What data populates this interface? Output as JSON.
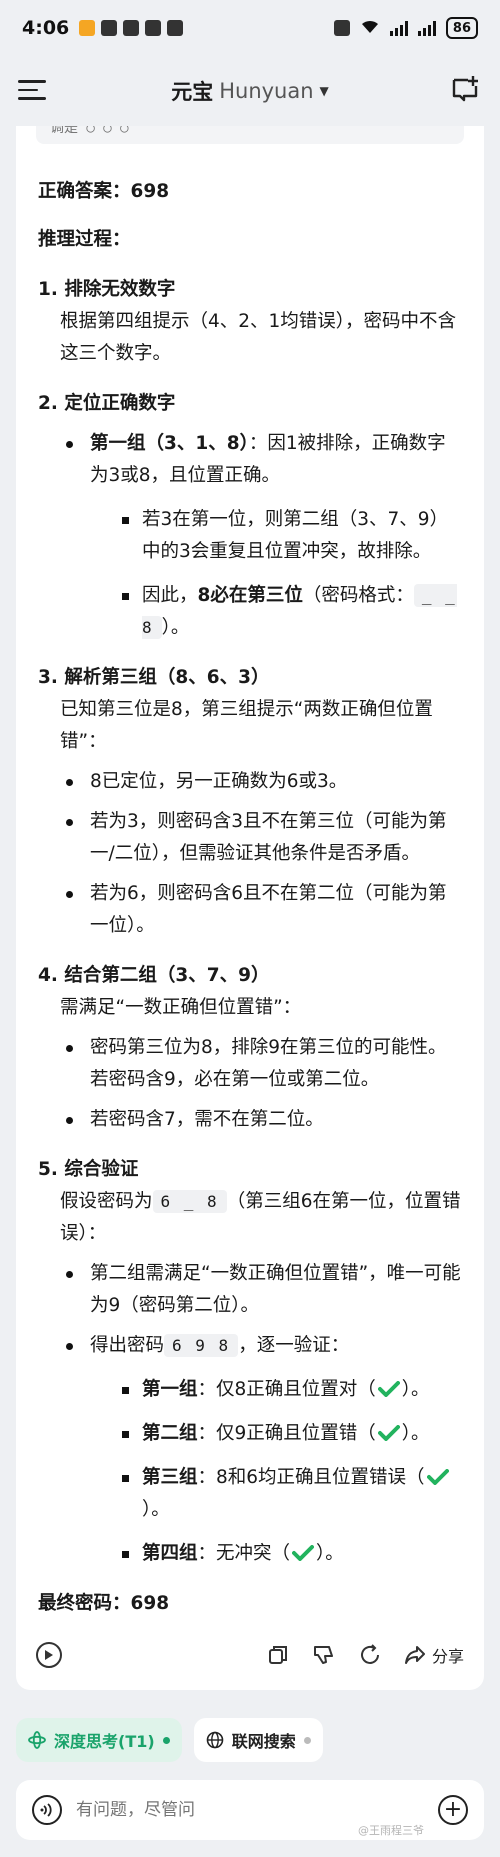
{
  "status": {
    "time": "4:06",
    "battery": "86"
  },
  "header": {
    "title": "元宝",
    "subtitle": "Hunyuan"
  },
  "answer": {
    "code_tail": "调是 ○ ○ ○",
    "answer_label": "正确答案：",
    "answer_value": "698",
    "process_label": "推理过程："
  },
  "steps": {
    "s1": {
      "title": "1. 排除无效数字",
      "body": "根据第四组提示（4、2、1均错误），密码中不含这三个数字。"
    },
    "s2": {
      "title": "2. 定位正确数字",
      "b1_tag": "第一组（3、1、8）",
      "b1_text": "：因1被排除，正确数字为3或8，且位置正确。",
      "sb1": "若3在第一位，则第二组（3、7、9）中的3会重复且位置冲突，故排除。",
      "sb2_pre": "因此，",
      "sb2_tag": "8必在第三位",
      "sb2_mid": "（密码格式：",
      "sb2_code": "_ _ 8",
      "sb2_post": "）。"
    },
    "s3": {
      "title": "3. 解析第三组（8、6、3）",
      "body": "已知第三位是8，第三组提示“两数正确但位置错”：",
      "b1": "8已定位，另一正确数为6或3。",
      "b2": "若为3，则密码含3且不在第三位（可能为第一/二位），但需验证其他条件是否矛盾。",
      "b3": "若为6，则密码含6且不在第二位（可能为第一位）。"
    },
    "s4": {
      "title": "4. 结合第二组（3、7、9）",
      "body": "需满足“一数正确但位置错”：",
      "b1": "密码第三位为8，排除9在第三位的可能性。若密码含9，必在第一位或第二位。",
      "b2": "若密码含7，需不在第二位。"
    },
    "s5": {
      "title": "5. 综合验证",
      "body_pre": "假设密码为",
      "body_code": "6 _ 8",
      "body_post": "（第三组6在第一位，位置错误）：",
      "b1": "第二组需满足“一数正确但位置错”，唯一可能为9（密码第二位）。",
      "b2_pre": "得出密码",
      "b2_code": "6 9 8",
      "b2_post": "，逐一验证：",
      "c1_tag": "第一组",
      "c1_text": "：仅8正确且位置对（",
      "c2_tag": "第二组",
      "c2_text": "：仅9正确且位置错（",
      "c3_tag": "第三组",
      "c3_text": "：8和6均正确且位置错误（",
      "c4_tag": "第四组",
      "c4_text": "：无冲突（",
      "close": "）。"
    }
  },
  "final": {
    "label": "最终密码：",
    "value": "698"
  },
  "actions": {
    "share_label": "分享"
  },
  "chips": {
    "deep_think": "深度思考(T1)",
    "web_search": "联网搜索"
  },
  "input": {
    "placeholder": "有问题，尽管问"
  },
  "watermark": "@王雨程三爷"
}
